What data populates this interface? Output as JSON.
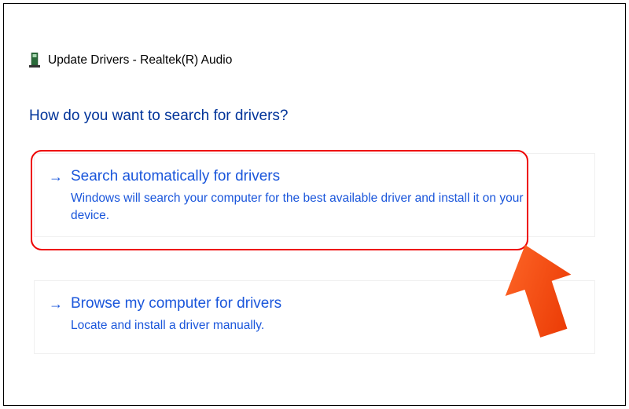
{
  "header": {
    "title": "Update Drivers - Realtek(R) Audio"
  },
  "heading": "How do you want to search for drivers?",
  "options": [
    {
      "arrow": "→",
      "title": "Search automatically for drivers",
      "description": "Windows will search your computer for the best available driver and install it on your device."
    },
    {
      "arrow": "→",
      "title": "Browse my computer for drivers",
      "description": "Locate and install a driver manually."
    }
  ]
}
